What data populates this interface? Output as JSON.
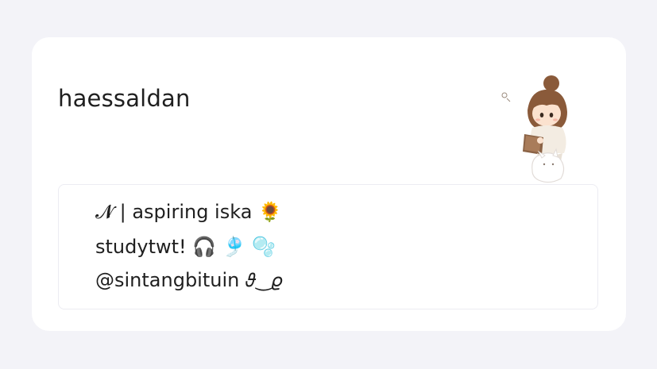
{
  "profile": {
    "username": "haessaldan",
    "bio": [
      "𝓝 | aspiring iska 🌻",
      "studytwt! 🎧 🎐 🫧",
      "@sintangbituin 𝜗‿𝜚"
    ]
  },
  "avatar": {
    "icon": "girl-reading-book-sticker-icon"
  },
  "colors": {
    "page_background": "#f3f3f8",
    "card_background": "#ffffff",
    "text": "#1f1f1f",
    "border": "#ececf2"
  }
}
